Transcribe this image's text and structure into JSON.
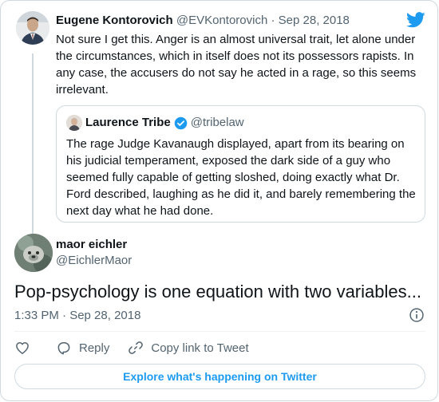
{
  "parent_tweet": {
    "name": "Eugene Kontorovich",
    "handle": "@EVKontorovich",
    "separator": "·",
    "date": "Sep 28, 2018",
    "text": "Not sure I get this.  Anger is an almost universal trait, let alone under the circumstances, which in itself does not its possessors rapists. In any case, the accusers do not say he acted in a rage, so this seems irrelevant."
  },
  "quoted_tweet": {
    "name": "Laurence Tribe",
    "handle": "@tribelaw",
    "verified": true,
    "text": "The rage Judge Kavanaugh displayed, apart from its bearing on his judicial temperament, exposed the dark side of a guy who seemed fully capable of getting sloshed, doing exactly what Dr. Ford described, laughing as he did it, and barely remembering the next day what he had done."
  },
  "main_tweet": {
    "name": "maor eichler",
    "handle": "@EichlerMaor",
    "text": "Pop-psychology is one equation with two variables...",
    "timestamp": "1:33 PM · Sep 28, 2018"
  },
  "actions": {
    "reply_label": "Reply",
    "copy_link_label": "Copy link to Tweet"
  },
  "explore_label": "Explore what's happening on Twitter",
  "colors": {
    "accent": "#1d9bf0",
    "text_primary": "#0f1419",
    "text_secondary": "#536471",
    "border": "#cfd9de"
  },
  "icons": [
    "twitter-bird-icon",
    "verified-badge-icon",
    "info-icon",
    "heart-icon",
    "reply-bubble-icon",
    "link-icon"
  ]
}
